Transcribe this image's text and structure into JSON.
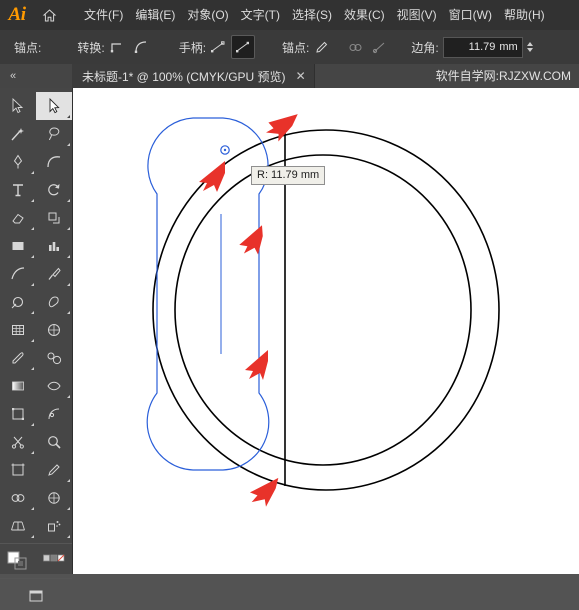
{
  "app": {
    "logo": "Ai",
    "home_icon": "home-icon"
  },
  "menubar": {
    "items": [
      {
        "label": "文件(F)"
      },
      {
        "label": "编辑(E)"
      },
      {
        "label": "对象(O)"
      },
      {
        "label": "文字(T)"
      },
      {
        "label": "选择(S)"
      },
      {
        "label": "效果(C)"
      },
      {
        "label": "视图(V)"
      },
      {
        "label": "窗口(W)"
      },
      {
        "label": "帮助(H)"
      }
    ]
  },
  "optionsbar": {
    "anchor_label": "锚点:",
    "convert_label": "转换:",
    "handles_label": "手柄:",
    "anchor_label2": "锚点:",
    "corner_label": "边角:",
    "corner_value": "11.79",
    "corner_unit": "mm"
  },
  "tabbar": {
    "collapse": "«",
    "doc_title": "未标题-1* @ 100% (CMYK/GPU 预览)",
    "close": "✕",
    "watermark": "软件自学网:RJZXW.COM"
  },
  "toolbar": {
    "tools": [
      {
        "name": "selection-tool",
        "label": "选择工具"
      },
      {
        "name": "direct-selection-tool",
        "label": "直接选择工具",
        "selected": true
      },
      {
        "name": "magic-wand-tool",
        "label": "魔棒工具"
      },
      {
        "name": "lasso-tool",
        "label": "套索工具"
      },
      {
        "name": "pen-tool",
        "label": "钢笔工具"
      },
      {
        "name": "curvature-tool",
        "label": "曲率工具"
      },
      {
        "name": "type-tool",
        "label": "文字工具"
      },
      {
        "name": "rotate-tool",
        "label": "旋转工具"
      },
      {
        "name": "eraser-tool",
        "label": "橡皮擦工具"
      },
      {
        "name": "scale-tool",
        "label": "比例缩放工具"
      },
      {
        "name": "rectangle-tool",
        "label": "矩形工具"
      },
      {
        "name": "column-graph-tool",
        "label": "柱形图工具"
      },
      {
        "name": "line-segment-tool",
        "label": "直线段工具"
      },
      {
        "name": "paintbrush-tool",
        "label": "画笔工具"
      },
      {
        "name": "shaper-tool",
        "label": "Shaper 工具"
      },
      {
        "name": "blob-brush-tool",
        "label": "斑点画笔工具"
      },
      {
        "name": "grid-tool",
        "label": "网格工具"
      },
      {
        "name": "mesh-tool",
        "label": "网格渐变工具"
      },
      {
        "name": "eyedropper-tool",
        "label": "吸管工具"
      },
      {
        "name": "blend-tool",
        "label": "混合工具"
      },
      {
        "name": "gradient-tool",
        "label": "渐变工具"
      },
      {
        "name": "width-tool",
        "label": "宽度工具"
      },
      {
        "name": "free-transform-tool",
        "label": "自由变换工具"
      },
      {
        "name": "puppet-warp-tool",
        "label": "操控变形工具"
      },
      {
        "name": "scissors-tool",
        "label": "剪刀工具"
      },
      {
        "name": "zoom-tool",
        "label": "缩放工具"
      },
      {
        "name": "artboard-tool",
        "label": "画板工具"
      },
      {
        "name": "slice-tool",
        "label": "切片工具"
      },
      {
        "name": "shape-builder-tool",
        "label": "形状生成器工具"
      },
      {
        "name": "live-paint-bucket-tool",
        "label": "实时上色工具"
      },
      {
        "name": "perspective-grid-tool",
        "label": "透视网格工具"
      },
      {
        "name": "symbol-sprayer-tool",
        "label": "符号喷枪工具"
      },
      {
        "name": "fill-stroke-swatch",
        "label": "填色和描边"
      },
      {
        "name": "color-mode-swatch",
        "label": "颜色模式"
      },
      {
        "name": "screen-mode-tool",
        "label": "屏幕模式"
      }
    ]
  },
  "canvas": {
    "radius_tooltip": "R: 11.79 mm",
    "annotations": {
      "arrow_color": "#e8322a",
      "path_color": "#2b5fd9",
      "shape_color": "#000000"
    }
  }
}
